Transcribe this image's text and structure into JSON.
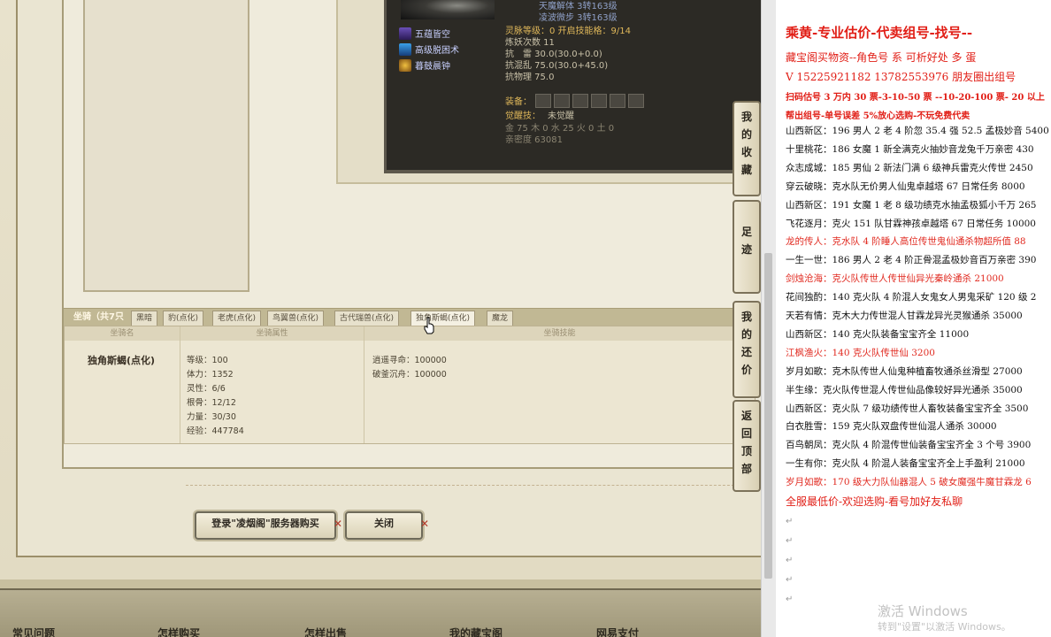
{
  "game": {
    "skills": [
      {
        "name": "五蕴皆空",
        "icon": "lotus-icon"
      },
      {
        "name": "高级脱困术",
        "icon": "magic-icon"
      },
      {
        "name": "暮鼓晨钟",
        "icon": "bell-icon"
      }
    ],
    "stats": {
      "line1": "天魔解体 3转163级",
      "line2": "凌波微步 3转163级",
      "spirit": "灵脉等级：0 开启技能格：9/14",
      "demon": "炼妖次数 11",
      "thunder": "抗　雷 30.0(30.0+0.0)",
      "chaos": "抗混乱 75.0(30.0+45.0)",
      "phys": "抗物理 75.0",
      "equip_label": "装备：",
      "awaken_label": "觉醒技：",
      "awaken_value": "未觉醒",
      "elements": "金 75 木 0 水 25 火 0 土 0",
      "intimacy": "亲密度 63081"
    },
    "tabs": [
      "坐骑（共7只",
      "黑暗",
      "豹(点化)",
      "老虎(点化)",
      "鸟翼兽(点化)",
      "古代瑞兽(点化)",
      "独角斯蝎(点化)",
      "魔龙"
    ],
    "table": {
      "col1": "坐骑名",
      "col2": "坐骑属性",
      "col3": "坐骑技能",
      "mount_name": "独角斯蝎(点化)",
      "attrs": [
        "等级：100",
        "体力：1352",
        "灵性：6/6",
        "根骨：12/12",
        "力量：30/30",
        "经验：447784"
      ],
      "skills": [
        "逍遥寻命：100000",
        "破釜沉舟：100000"
      ]
    },
    "buttons": {
      "buy": "登录\"凌烟阁\"服务器购买",
      "close": "关闭"
    },
    "footer": [
      "常见问题",
      "怎样购买",
      "怎样出售",
      "我的藏宝阁",
      "网易支付"
    ],
    "sidetabs": [
      [
        "我",
        "的",
        "收",
        "藏"
      ],
      [
        "足",
        "迹"
      ],
      [
        "我",
        "的",
        "还",
        "价"
      ],
      [
        "返",
        "回",
        "顶",
        "部"
      ]
    ]
  },
  "doc": {
    "title": "乘黄-专业估价-代卖组号-找号--",
    "line2": "藏宝阁买物资--角色号 系 可析好处 多 蛋",
    "line3": "V 15225921182   13782553976 朋友圈出组号",
    "line4": "扫码估号 3 万内 30 票-3-10-50 票 --10-20-100 票- 20 以上",
    "line5": "帮出组号-单号误差 5%放心选购-不玩免费代卖",
    "entries": [
      {
        "text": "山西新区：196 男人 2 老 4 阶忽 35.4 强 52.5 孟极妙音 5400",
        "red": false
      },
      {
        "text": "十里桃花：186 女魔 1 新全满克火抽妙音龙兔千万亲密 430",
        "red": false
      },
      {
        "text": "众志成城：185 男仙 2 新法门满 6 级神兵雷克火传世 2450",
        "red": false
      },
      {
        "text": "穿云破晓：克水队无价男人仙鬼卓越塔 67 日常任务 8000",
        "red": false
      },
      {
        "text": "山西新区：191 女魔 1 老 8 级功绩克水抽孟极狐小千万 265",
        "red": false
      },
      {
        "text": "飞花逐月：克火 151 队甘霖神孩卓越塔 67 日常任务 10000",
        "red": false
      },
      {
        "text": "龙的传人：克水队 4 阶睡人高位传世鬼仙通杀物超所值 88",
        "red": true
      },
      {
        "text": "一生一世：186 男人 2 老 4 阶正骨混孟极妙音百万亲密 390",
        "red": false
      },
      {
        "text": "剑烛沧海：克火队传世人传世仙异光秦岭通杀 21000",
        "red": true
      },
      {
        "text": "花间独酌：140 克火队 4 阶混人女鬼女人男鬼采矿 120 级 2",
        "red": false
      },
      {
        "text": "天若有情：克木大力传世混人甘霖龙异光灵猴通杀 35000",
        "red": false
      },
      {
        "text": "山西新区：140 克火队装备宝宝齐全 11000",
        "red": false
      },
      {
        "text": "江枫渔火：140 克火队传世仙 3200",
        "red": true
      },
      {
        "text": "岁月如歌：克木队传世人仙鬼种植畜牧通杀丝滑型 27000",
        "red": false
      },
      {
        "text": "半生缘：克火队传世混人传世仙品像较好异光通杀 35000",
        "red": false
      },
      {
        "text": "山西新区：克火队 7 级功绩传世人畜牧装备宝宝齐全 3500",
        "red": false
      },
      {
        "text": "白衣胜雪：159 克火队双盘传世仙混人通杀 30000",
        "red": false
      },
      {
        "text": "百鸟朝凤：克火队 4 阶混传世仙装备宝宝齐全 3 个号 3900",
        "red": false
      },
      {
        "text": "一生有你：克火队 4 阶混人装备宝宝齐全上手盈利 21000",
        "red": false
      },
      {
        "text": "岁月如歌：170 级大力队仙器混人 5 破女魔强牛魔甘霖龙 6",
        "red": true
      }
    ],
    "closing": "全服最低价-欢迎选购-看号加好友私聊",
    "watermark1": "激活 Windows",
    "watermark2": "转到\"设置\"以激活 Windows。"
  }
}
